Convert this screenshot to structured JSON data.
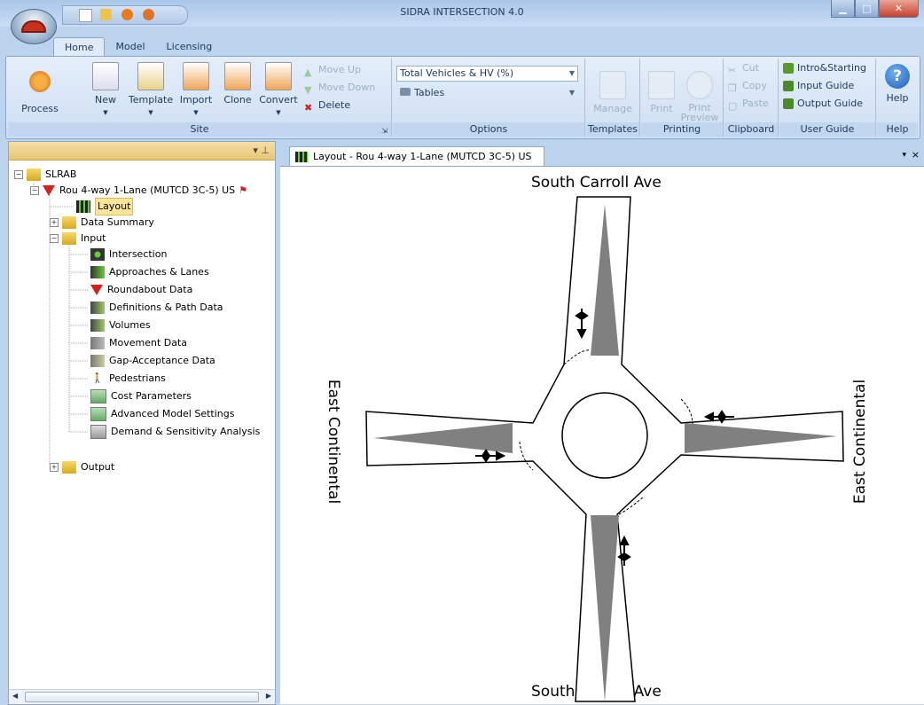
{
  "window": {
    "title": "SIDRA INTERSECTION 4.0"
  },
  "ribbon_tabs": [
    {
      "label": "Home"
    },
    {
      "label": "Model"
    },
    {
      "label": "Licensing"
    }
  ],
  "ribbon": {
    "site": {
      "label": "Site",
      "process": "Process",
      "new": "New",
      "template": "Template",
      "import": "Import",
      "clone": "Clone",
      "convert": "Convert",
      "move_up": "Move Up",
      "move_down": "Move Down",
      "delete": "Delete"
    },
    "options": {
      "label": "Options",
      "vehicles_select": "Total Vehicles & HV (%)",
      "tables_select": "Tables"
    },
    "templates": {
      "label": "Templates",
      "manage": "Manage"
    },
    "printing": {
      "label": "Printing",
      "print": "Print",
      "print_preview": "Print Preview"
    },
    "clipboard": {
      "label": "Clipboard",
      "cut": "Cut",
      "copy": "Copy",
      "paste": "Paste"
    },
    "user_guide": {
      "label": "User Guide",
      "intro": "Intro&Starting",
      "input_guide": "Input Guide",
      "output_guide": "Output Guide"
    },
    "help": {
      "label": "Help",
      "help": "Help"
    }
  },
  "tree": {
    "root": "SLRAB",
    "site": "Rou 4-way 1-Lane (MUTCD 3C-5) US",
    "layout": "Layout",
    "data_summary": "Data Summary",
    "input": "Input",
    "input_items": [
      "Intersection",
      "Approaches & Lanes",
      "Roundabout Data",
      "Definitions & Path Data",
      "Volumes",
      "Movement Data",
      "Gap-Acceptance Data",
      "Pedestrians",
      "Cost Parameters",
      "Advanced Model Settings",
      "Demand & Sensitivity Analysis"
    ],
    "output": "Output"
  },
  "document": {
    "tab_title": "Layout - Rou 4-way 1-Lane (MUTCD 3C-5) US"
  },
  "diagram": {
    "north_label": "South Carroll Ave",
    "south_label": "South Carroll Ave",
    "west_label": "East Continental",
    "east_label": "East Continental"
  },
  "colors": {
    "island": "#808080",
    "road": "#ffffff",
    "outline": "#000000"
  }
}
